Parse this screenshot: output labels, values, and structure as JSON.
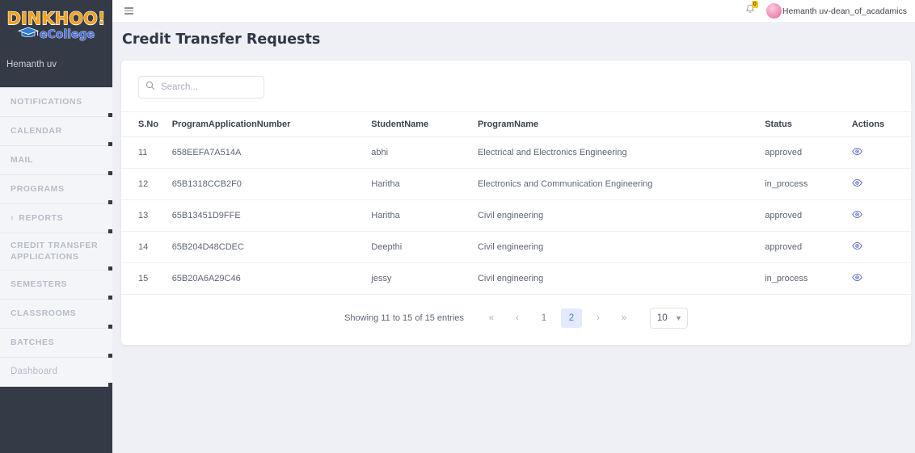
{
  "sidebar": {
    "logo": {
      "main": "DINKHOO!",
      "sub": "eCollege",
      "cap_icon": "graduation-cap-icon"
    },
    "user_name": "Hemanth uv",
    "items": [
      {
        "label": "NOTIFICATIONS",
        "has_chevron": false,
        "style": "upper"
      },
      {
        "label": "CALENDAR",
        "has_chevron": false,
        "style": "upper"
      },
      {
        "label": "MAIL",
        "has_chevron": false,
        "style": "upper"
      },
      {
        "label": "PROGRAMS",
        "has_chevron": false,
        "style": "upper"
      },
      {
        "label": "REPORTS",
        "has_chevron": true,
        "style": "upper"
      },
      {
        "label": "CREDIT TRANSFER APPLICATIONS",
        "has_chevron": false,
        "style": "upper"
      },
      {
        "label": "SEMESTERS",
        "has_chevron": false,
        "style": "upper"
      },
      {
        "label": "CLASSROOMS",
        "has_chevron": false,
        "style": "upper"
      },
      {
        "label": "BATCHES",
        "has_chevron": false,
        "style": "upper"
      },
      {
        "label": "Dashboard",
        "has_chevron": false,
        "style": "mixed"
      }
    ]
  },
  "topbar": {
    "menu_icon": "hamburger-icon",
    "bell_icon": "bell-icon",
    "bell_badge": "0",
    "avatar_icon": "user-avatar",
    "user_label": "Hemanth uv-dean_of_acadamics"
  },
  "page": {
    "title": "Credit Transfer Requests"
  },
  "search": {
    "placeholder": "Search...",
    "value": "",
    "icon": "search-icon"
  },
  "table": {
    "columns": [
      "S.No",
      "ProgramApplicationNumber",
      "StudentName",
      "ProgramName",
      "Status",
      "Actions"
    ],
    "rows": [
      {
        "sno": "11",
        "application_number": "658EEFA7A514A",
        "student": "abhi",
        "program": "Electrical and Electronics Engineering",
        "status": "approved",
        "action_icon": "eye-icon"
      },
      {
        "sno": "12",
        "application_number": "65B1318CCB2F0",
        "student": "Haritha",
        "program": "Electronics and Communication Engineering",
        "status": "in_process",
        "action_icon": "eye-icon"
      },
      {
        "sno": "13",
        "application_number": "65B13451D9FFE",
        "student": "Haritha",
        "program": "Civil engineering",
        "status": "approved",
        "action_icon": "eye-icon"
      },
      {
        "sno": "14",
        "application_number": "65B204D48CDEC",
        "student": "Deepthi",
        "program": "Civil engineering",
        "status": "approved",
        "action_icon": "eye-icon"
      },
      {
        "sno": "15",
        "application_number": "65B20A6A29C46",
        "student": "jessy",
        "program": "Civil engineering",
        "status": "in_process",
        "action_icon": "eye-icon"
      }
    ]
  },
  "pagination": {
    "info": "Showing 11 to 15 of 15 entries",
    "first_label": "«",
    "prev_label": "‹",
    "pages": [
      "1",
      "2"
    ],
    "active_page": "2",
    "next_label": "›",
    "last_label": "»",
    "page_size": "10",
    "caret_icon": "chevron-down-icon"
  },
  "colors": {
    "sidebar_bg": "#343a46",
    "page_bg": "#eef0f5",
    "accent_blue": "#4a7df4",
    "eye_icon": "#5b66c9",
    "badge_yellow": "#f7c824"
  }
}
